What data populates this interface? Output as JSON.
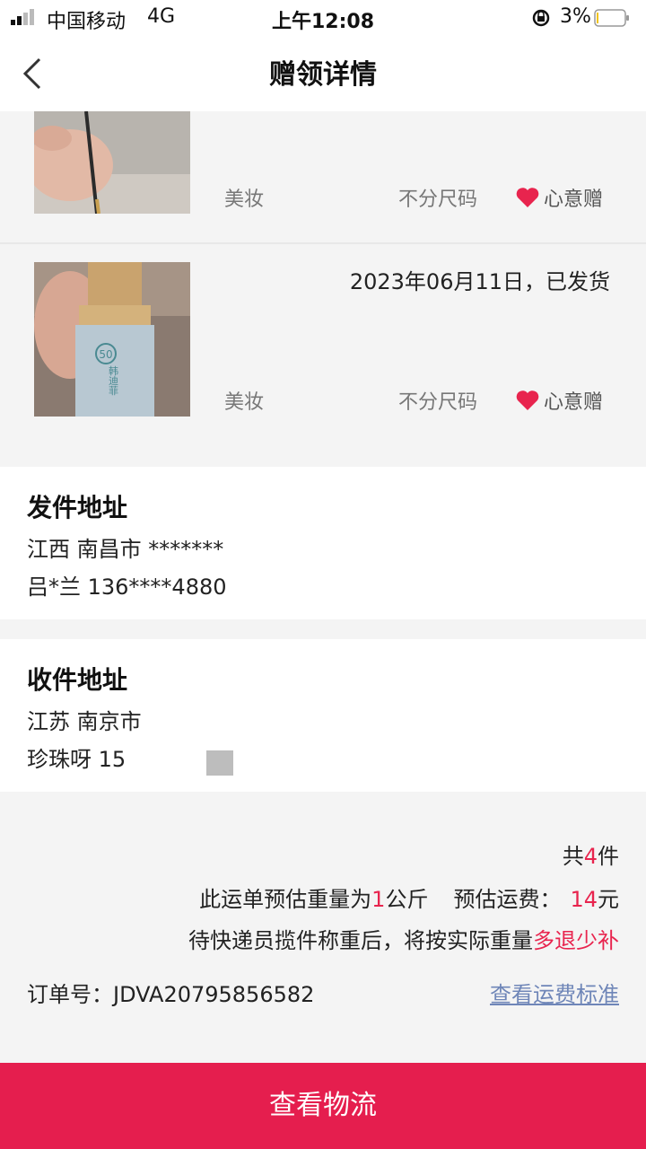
{
  "status_bar": {
    "carrier": "中国移动",
    "network": "4G",
    "time": "上午12:08",
    "battery_percent": "3%"
  },
  "nav": {
    "title": "赠领详情"
  },
  "items": [
    {
      "category": "美妆",
      "size": "不分尺码",
      "gift_type": "心意赠",
      "image": "photo of a pencil in hand"
    },
    {
      "status": "2023年06月11日，已发货",
      "category": "美妆",
      "size": "不分尺码",
      "gift_type": "心意赠",
      "image": "photo of a cosmetic bottle with 韩迪菲 label",
      "bottle_number": "50",
      "bottle_text": "韩迪菲"
    }
  ],
  "sender": {
    "title": "发件地址",
    "address": "江西 南昌市 *******",
    "contact": "吕*兰 136****4880"
  },
  "receiver": {
    "title": "收件地址",
    "address": "江苏 南京市",
    "contact": "珍珠呀 15"
  },
  "summary": {
    "total_prefix": "共",
    "total_count": "4",
    "total_suffix": "件",
    "weight_prefix": "此运单预估重量为",
    "weight_value": "1",
    "weight_suffix": "公斤",
    "fee_prefix": "预估运费：",
    "fee_value": "14",
    "fee_suffix": "元",
    "note_prefix": "待快递员揽件称重后，将按实际重量",
    "note_highlight": "多退少补",
    "order_label": "订单号：",
    "order_number": "JDVA20795856582",
    "fee_link": "查看运费标准"
  },
  "bottom_button": {
    "label": "查看物流"
  },
  "colors": {
    "accent": "#e51e4e",
    "link": "#6f86b8",
    "background": "#f4f4f4"
  }
}
